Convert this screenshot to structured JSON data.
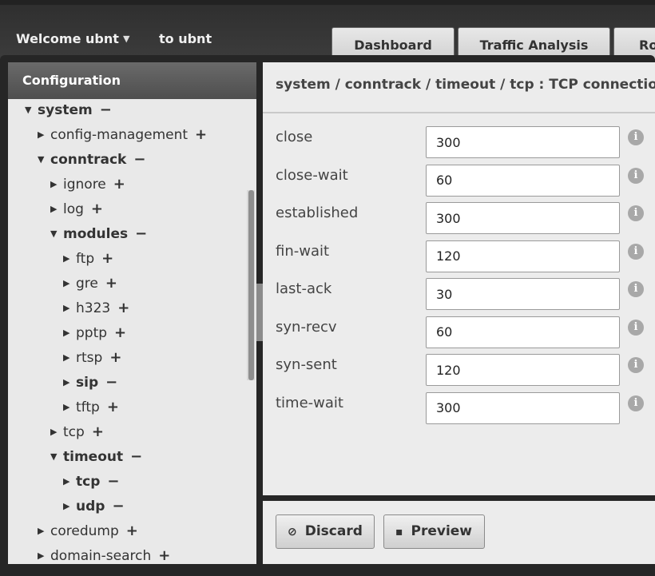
{
  "header": {
    "welcome": "Welcome ubnt",
    "to_user": "to ubnt",
    "tabs": [
      "Dashboard",
      "Traffic Analysis",
      "Ro"
    ]
  },
  "sidebar": {
    "title": "Configuration",
    "tree": [
      {
        "label": "system",
        "action": "−",
        "bold": true,
        "expanded": true,
        "depth": 0
      },
      {
        "label": "config-management",
        "action": "+",
        "bold": false,
        "expanded": false,
        "depth": 1
      },
      {
        "label": "conntrack",
        "action": "−",
        "bold": true,
        "expanded": true,
        "depth": 1
      },
      {
        "label": "ignore",
        "action": "+",
        "bold": false,
        "expanded": false,
        "depth": 2
      },
      {
        "label": "log",
        "action": "+",
        "bold": false,
        "expanded": false,
        "depth": 2
      },
      {
        "label": "modules",
        "action": "−",
        "bold": true,
        "expanded": true,
        "depth": 2
      },
      {
        "label": "ftp",
        "action": "+",
        "bold": false,
        "expanded": false,
        "depth": 3
      },
      {
        "label": "gre",
        "action": "+",
        "bold": false,
        "expanded": false,
        "depth": 3
      },
      {
        "label": "h323",
        "action": "+",
        "bold": false,
        "expanded": false,
        "depth": 3
      },
      {
        "label": "pptp",
        "action": "+",
        "bold": false,
        "expanded": false,
        "depth": 3
      },
      {
        "label": "rtsp",
        "action": "+",
        "bold": false,
        "expanded": false,
        "depth": 3
      },
      {
        "label": "sip",
        "action": "−",
        "bold": true,
        "expanded": false,
        "depth": 3
      },
      {
        "label": "tftp",
        "action": "+",
        "bold": false,
        "expanded": false,
        "depth": 3
      },
      {
        "label": "tcp",
        "action": "+",
        "bold": false,
        "expanded": false,
        "depth": 2
      },
      {
        "label": "timeout",
        "action": "−",
        "bold": true,
        "expanded": true,
        "depth": 2
      },
      {
        "label": "tcp",
        "action": "−",
        "bold": true,
        "expanded": false,
        "depth": 3
      },
      {
        "label": "udp",
        "action": "−",
        "bold": true,
        "expanded": false,
        "depth": 3
      },
      {
        "label": "coredump",
        "action": "+",
        "bold": false,
        "expanded": false,
        "depth": 1
      },
      {
        "label": "domain-search",
        "action": "+",
        "bold": false,
        "expanded": false,
        "depth": 1
      }
    ]
  },
  "main": {
    "title": "system / conntrack / timeout / tcp : TCP connection",
    "fields": [
      {
        "label": "close",
        "value": "300"
      },
      {
        "label": "close-wait",
        "value": "60"
      },
      {
        "label": "established",
        "value": "300"
      },
      {
        "label": "fin-wait",
        "value": "120"
      },
      {
        "label": "last-ack",
        "value": "30"
      },
      {
        "label": "syn-recv",
        "value": "60"
      },
      {
        "label": "syn-sent",
        "value": "120"
      },
      {
        "label": "time-wait",
        "value": "300"
      }
    ],
    "info_glyph": "i"
  },
  "footer": {
    "discard_label": "Discard",
    "preview_label": "Preview"
  },
  "icons": {
    "expanded": "arrow-down-icon",
    "collapsed": "arrow-right-icon",
    "discard": "ban-icon",
    "preview": "save-icon"
  }
}
